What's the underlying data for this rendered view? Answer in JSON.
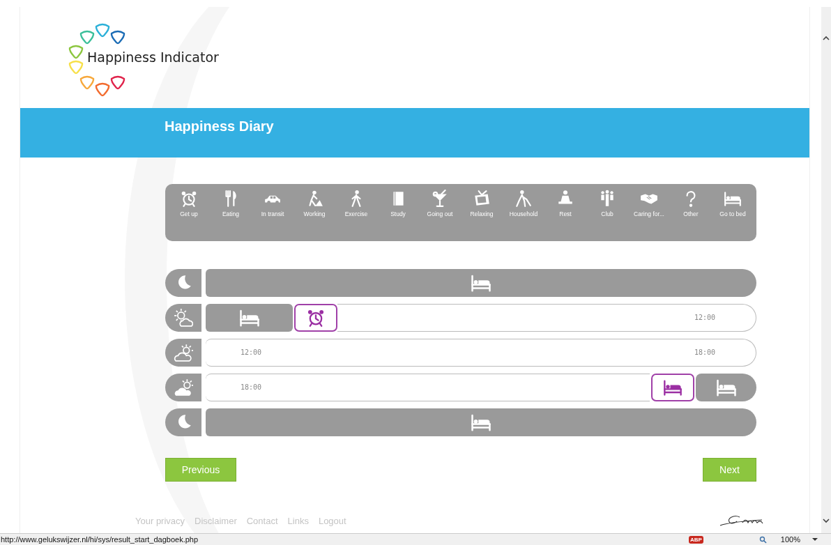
{
  "logo": {
    "title": "Happiness Indicator"
  },
  "banner": {
    "title": "Happiness Diary"
  },
  "activities": [
    {
      "label": "Get up"
    },
    {
      "label": "Eating"
    },
    {
      "label": "In transit"
    },
    {
      "label": "Working"
    },
    {
      "label": "Exercise"
    },
    {
      "label": "Study"
    },
    {
      "label": "Going out"
    },
    {
      "label": "Relaxing"
    },
    {
      "label": "Household"
    },
    {
      "label": "Rest"
    },
    {
      "label": "Club"
    },
    {
      "label": "Caring for..."
    },
    {
      "label": "Other"
    },
    {
      "label": "Go to bed"
    }
  ],
  "diary_rows": [
    {
      "kind": "night",
      "segments": [
        {
          "kind": "asleep",
          "wide": true
        }
      ]
    },
    {
      "kind": "morning",
      "segments": [
        {
          "kind": "asleep",
          "wide": false
        },
        {
          "kind": "wake-marker"
        },
        {
          "kind": "day",
          "end": "12:00"
        }
      ]
    },
    {
      "kind": "afternoon",
      "segments": [
        {
          "kind": "day",
          "start": "12:00",
          "end": "18:00"
        }
      ]
    },
    {
      "kind": "evening",
      "segments": [
        {
          "kind": "day",
          "start": "18:00"
        },
        {
          "kind": "bed-marker"
        },
        {
          "kind": "asleep",
          "wide": false
        }
      ]
    },
    {
      "kind": "night",
      "segments": [
        {
          "kind": "asleep",
          "wide": true
        }
      ]
    }
  ],
  "buttons": {
    "previous": "Previous",
    "next": "Next"
  },
  "footer_links": [
    "Your privacy",
    "Disclaimer",
    "Contact",
    "Links",
    "Logout"
  ],
  "status_bar": {
    "url": "http://www.gelukswijzer.nl/hi/sys/result_start_dagboek.php",
    "adblock_badge": "ABP",
    "zoom": "100%"
  }
}
